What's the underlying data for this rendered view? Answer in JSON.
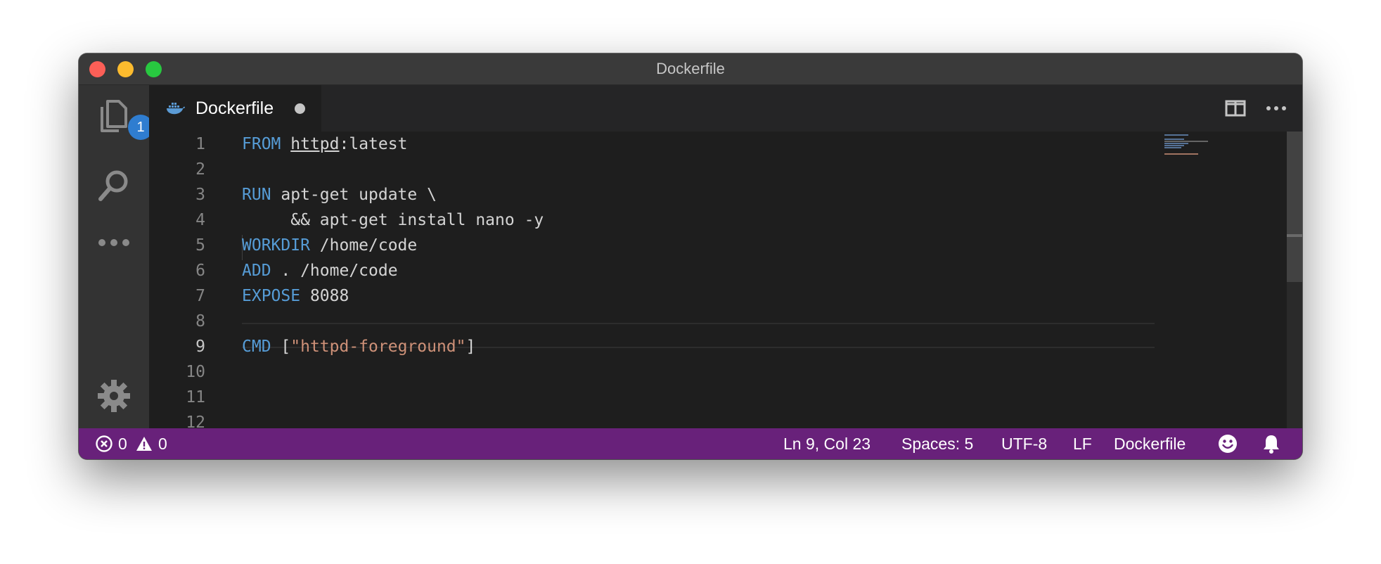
{
  "window": {
    "title": "Dockerfile"
  },
  "activity_bar": {
    "items": [
      {
        "icon": "files-icon"
      },
      {
        "icon": "search-icon"
      },
      {
        "icon": "more-icon"
      },
      {
        "icon": "gear-icon"
      }
    ],
    "explorer_badge": "1"
  },
  "tabs": [
    {
      "icon": "docker-icon",
      "label": "Dockerfile",
      "dirty": true
    }
  ],
  "tab_actions": [
    "split-editor-icon",
    "more-actions-icon"
  ],
  "editor": {
    "language": "Dockerfile",
    "line_numbers": [
      "1",
      "2",
      "3",
      "4",
      "5",
      "6",
      "7",
      "8",
      "9",
      "10",
      "11",
      "12"
    ],
    "active_line": 9,
    "lines": [
      {
        "kw": "FROM",
        "text": " ",
        "link": "httpd",
        "rest": ":latest"
      },
      {
        "kw": "",
        "text": ""
      },
      {
        "kw": "RUN",
        "text": " apt-get update \\"
      },
      {
        "kw": "",
        "text": "     && apt-get install nano -y"
      },
      {
        "kw": "WORKDIR",
        "text": " /home/code"
      },
      {
        "kw": "ADD",
        "text": " . /home/code"
      },
      {
        "kw": "EXPOSE",
        "text": " 8088"
      },
      {
        "kw": "",
        "text": ""
      },
      {
        "kw": "CMD",
        "text": " [",
        "str": "\"httpd-foreground\"",
        "rest": "]"
      }
    ]
  },
  "statusbar": {
    "errors": "0",
    "warnings": "0",
    "position": "Ln 9, Col 23",
    "indentation": "Spaces: 5",
    "encoding": "UTF-8",
    "eol": "LF",
    "language_mode": "Dockerfile",
    "icons": [
      "error-icon",
      "warning-icon",
      "feedback-icon",
      "bell-icon"
    ]
  },
  "colors": {
    "statusbar_bg": "#68217a",
    "editor_bg": "#1e1e1e",
    "keyword": "#569cd6",
    "string": "#ce9178",
    "badge": "#2f7dd0"
  }
}
